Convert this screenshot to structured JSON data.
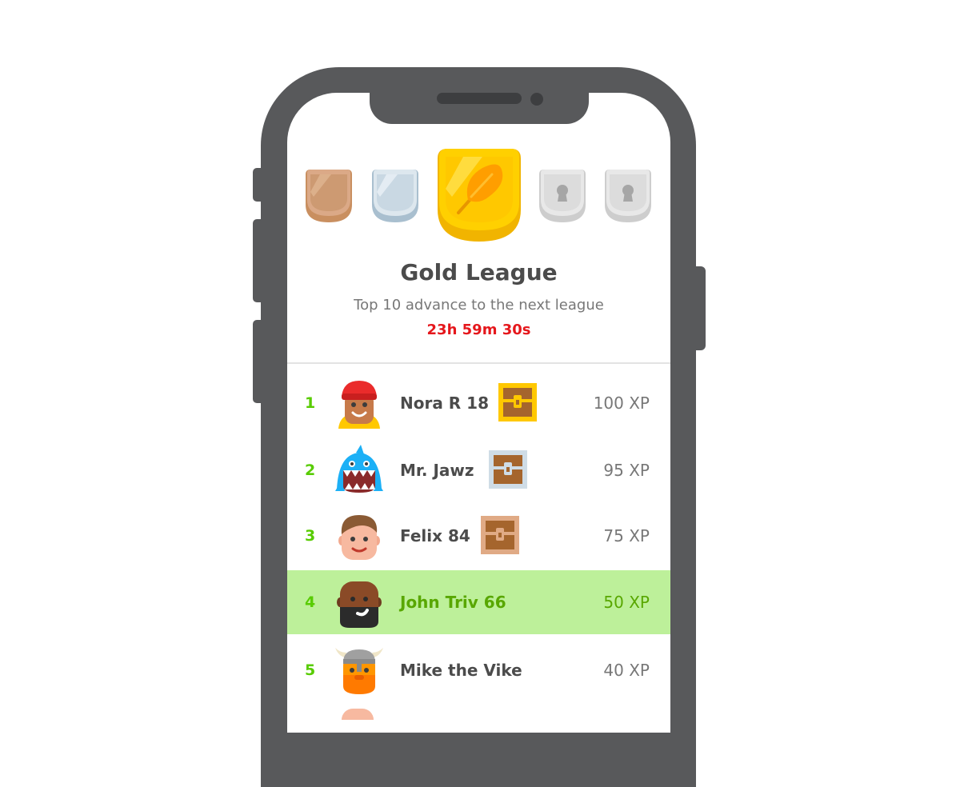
{
  "leagues": [
    {
      "name": "bronze-league-badge",
      "color": "#cd9a72",
      "locked": false
    },
    {
      "name": "silver-league-badge",
      "color": "#cfdce6",
      "locked": false
    },
    {
      "name": "gold-league-badge",
      "color": "#ffd400",
      "locked": false,
      "current": true
    },
    {
      "name": "locked-league-badge",
      "color": "#e5e5e5",
      "locked": true
    },
    {
      "name": "locked-league-badge",
      "color": "#e5e5e5",
      "locked": true
    }
  ],
  "league": {
    "title": "Gold League",
    "subtitle": "Top 10 advance to the next league",
    "timer": "23h 59m 30s"
  },
  "leaderboard": [
    {
      "rank": "1",
      "name": "Nora R 18",
      "xp": "100 XP",
      "chest": "gold",
      "avatar": "red-beanie-avatar"
    },
    {
      "rank": "2",
      "name": "Mr. Jawz",
      "xp": "95 XP",
      "chest": "silver",
      "avatar": "shark-avatar"
    },
    {
      "rank": "3",
      "name": "Felix 84",
      "xp": "75 XP",
      "chest": "bronze",
      "avatar": "brown-hair-avatar"
    },
    {
      "rank": "4",
      "name": "John Triv 66",
      "xp": "50 XP",
      "chest": null,
      "avatar": "bearded-avatar",
      "current_user": true
    },
    {
      "rank": "5",
      "name": "Mike the Vike",
      "xp": "40 XP",
      "chest": null,
      "avatar": "viking-avatar"
    }
  ],
  "colors": {
    "accent": "#58cc02",
    "highlight_row": "#bdf09a",
    "timer": "#e5171c",
    "phone": "#58595b"
  }
}
